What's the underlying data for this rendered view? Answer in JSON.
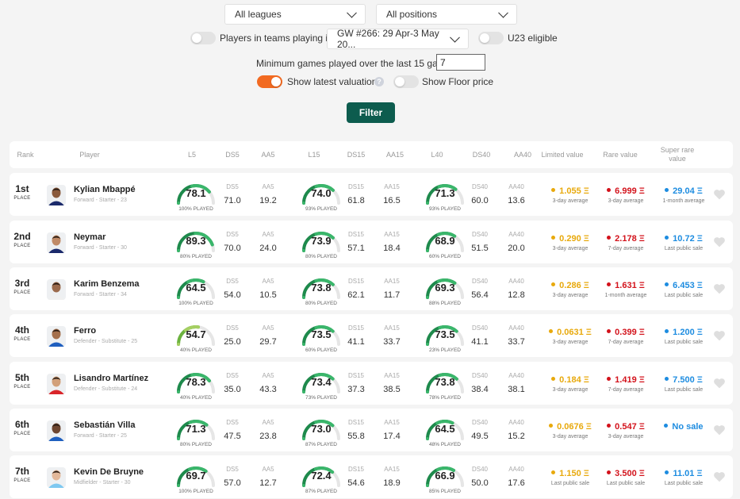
{
  "filters": {
    "league": "All leagues",
    "position": "All positions",
    "teams_playing_label": "Players in teams playing in",
    "gameweek": "GW #266: 29 Apr-3 May 20...",
    "u23_label": "U23 eligible",
    "min_games_label": "Minimum games played over the last 15 games:",
    "min_games_value": "7",
    "latest_valuation_label": "Show latest valuation",
    "help_glyph": "?",
    "floor_price_label": "Show Floor price",
    "filter_button": "Filter"
  },
  "headers": {
    "rank": "Rank",
    "player": "Player",
    "l5": "L5",
    "ds5": "DS5",
    "aa5": "AA5",
    "l15": "L15",
    "ds15": "DS15",
    "aa15": "AA15",
    "l40": "L40",
    "ds40": "DS40",
    "aa40": "AA40",
    "limited": "Limited value",
    "rare": "Rare value",
    "super_rare": "Super rare value"
  },
  "colors": {
    "limited": "#e8a90c",
    "rare": "#d3121b",
    "super_rare": "#1d8ce0",
    "filter_button": "#0d5c4e",
    "toggle_on": "#f26a21"
  },
  "rows": [
    {
      "rank": "1st",
      "place": "PLACE",
      "name": "Kylian Mbappé",
      "info": "Forward - Starter - 23",
      "l5": {
        "v": "78.1",
        "p": "100% PLAYED"
      },
      "ds5": "71.0",
      "aa5": "19.2",
      "l15": {
        "v": "74.0",
        "p": "93% PLAYED"
      },
      "ds15": "61.8",
      "aa15": "16.5",
      "l40": {
        "v": "71.3",
        "p": "93% PLAYED"
      },
      "ds40": "60.0",
      "aa40": "13.6",
      "limited": {
        "v": "1.055 Ξ",
        "s": "3-day average"
      },
      "rare": {
        "v": "6.999 Ξ",
        "s": "3-day average"
      },
      "super_rare": {
        "v": "29.04 Ξ",
        "s": "1-month average"
      }
    },
    {
      "rank": "2nd",
      "place": "PLACE",
      "name": "Neymar",
      "info": "Forward - Starter - 30",
      "l5": {
        "v": "89.3",
        "p": "80% PLAYED"
      },
      "ds5": "70.0",
      "aa5": "24.0",
      "l15": {
        "v": "73.9",
        "p": "80% PLAYED"
      },
      "ds15": "57.1",
      "aa15": "18.4",
      "l40": {
        "v": "68.9",
        "p": "60% PLAYED"
      },
      "ds40": "51.5",
      "aa40": "20.0",
      "limited": {
        "v": "0.290 Ξ",
        "s": "3-day average"
      },
      "rare": {
        "v": "2.178 Ξ",
        "s": "7-day average"
      },
      "super_rare": {
        "v": "10.72 Ξ",
        "s": "Last public sale"
      }
    },
    {
      "rank": "3rd",
      "place": "PLACE",
      "name": "Karim Benzema",
      "info": "Forward - Starter - 34",
      "l5": {
        "v": "64.5",
        "p": "100% PLAYED"
      },
      "ds5": "54.0",
      "aa5": "10.5",
      "l15": {
        "v": "73.8",
        "p": "80% PLAYED"
      },
      "ds15": "62.1",
      "aa15": "11.7",
      "l40": {
        "v": "69.3",
        "p": "88% PLAYED"
      },
      "ds40": "56.4",
      "aa40": "12.8",
      "limited": {
        "v": "0.286 Ξ",
        "s": "3-day average"
      },
      "rare": {
        "v": "1.631 Ξ",
        "s": "1-month average"
      },
      "super_rare": {
        "v": "6.453 Ξ",
        "s": "Last public sale"
      }
    },
    {
      "rank": "4th",
      "place": "PLACE",
      "name": "Ferro",
      "info": "Defender - Substitute - 25",
      "l5": {
        "v": "54.7",
        "p": "40% PLAYED"
      },
      "ds5": "25.0",
      "aa5": "29.7",
      "l15": {
        "v": "73.5",
        "p": "60% PLAYED"
      },
      "ds15": "41.1",
      "aa15": "33.7",
      "l40": {
        "v": "73.5",
        "p": "23% PLAYED"
      },
      "ds40": "41.1",
      "aa40": "33.7",
      "limited": {
        "v": "0.0631 Ξ",
        "s": "3-day average"
      },
      "rare": {
        "v": "0.399 Ξ",
        "s": "7-day average"
      },
      "super_rare": {
        "v": "1.200 Ξ",
        "s": "Last public sale"
      }
    },
    {
      "rank": "5th",
      "place": "PLACE",
      "name": "Lisandro Martínez",
      "info": "Defender - Substitute - 24",
      "l5": {
        "v": "78.3",
        "p": "40% PLAYED"
      },
      "ds5": "35.0",
      "aa5": "43.3",
      "l15": {
        "v": "73.4",
        "p": "73% PLAYED"
      },
      "ds15": "37.3",
      "aa15": "38.5",
      "l40": {
        "v": "73.8",
        "p": "78% PLAYED"
      },
      "ds40": "38.4",
      "aa40": "38.1",
      "limited": {
        "v": "0.184 Ξ",
        "s": "3-day average"
      },
      "rare": {
        "v": "1.419 Ξ",
        "s": "7-day average"
      },
      "super_rare": {
        "v": "7.500 Ξ",
        "s": "Last public sale"
      }
    },
    {
      "rank": "6th",
      "place": "PLACE",
      "name": "Sebastián Villa",
      "info": "Forward - Starter - 25",
      "l5": {
        "v": "71.3",
        "p": "80% PLAYED"
      },
      "ds5": "47.5",
      "aa5": "23.8",
      "l15": {
        "v": "73.0",
        "p": "87% PLAYED"
      },
      "ds15": "55.8",
      "aa15": "17.4",
      "l40": {
        "v": "64.5",
        "p": "48% PLAYED"
      },
      "ds40": "49.5",
      "aa40": "15.2",
      "limited": {
        "v": "0.0676 Ξ",
        "s": "3-day average"
      },
      "rare": {
        "v": "0.547 Ξ",
        "s": "3-day average"
      },
      "super_rare": {
        "v": "No sale",
        "s": ""
      }
    },
    {
      "rank": "7th",
      "place": "PLACE",
      "name": "Kevin De Bruyne",
      "info": "Midfielder - Starter - 30",
      "l5": {
        "v": "69.7",
        "p": "100% PLAYED"
      },
      "ds5": "57.0",
      "aa5": "12.7",
      "l15": {
        "v": "72.4",
        "p": "87% PLAYED"
      },
      "ds15": "54.6",
      "aa15": "18.9",
      "l40": {
        "v": "66.9",
        "p": "85% PLAYED"
      },
      "ds40": "50.0",
      "aa40": "17.6",
      "limited": {
        "v": "1.150 Ξ",
        "s": "Last public sale"
      },
      "rare": {
        "v": "3.500 Ξ",
        "s": "Last public sale"
      },
      "super_rare": {
        "v": "11.01 Ξ",
        "s": "Last public sale"
      }
    }
  ]
}
